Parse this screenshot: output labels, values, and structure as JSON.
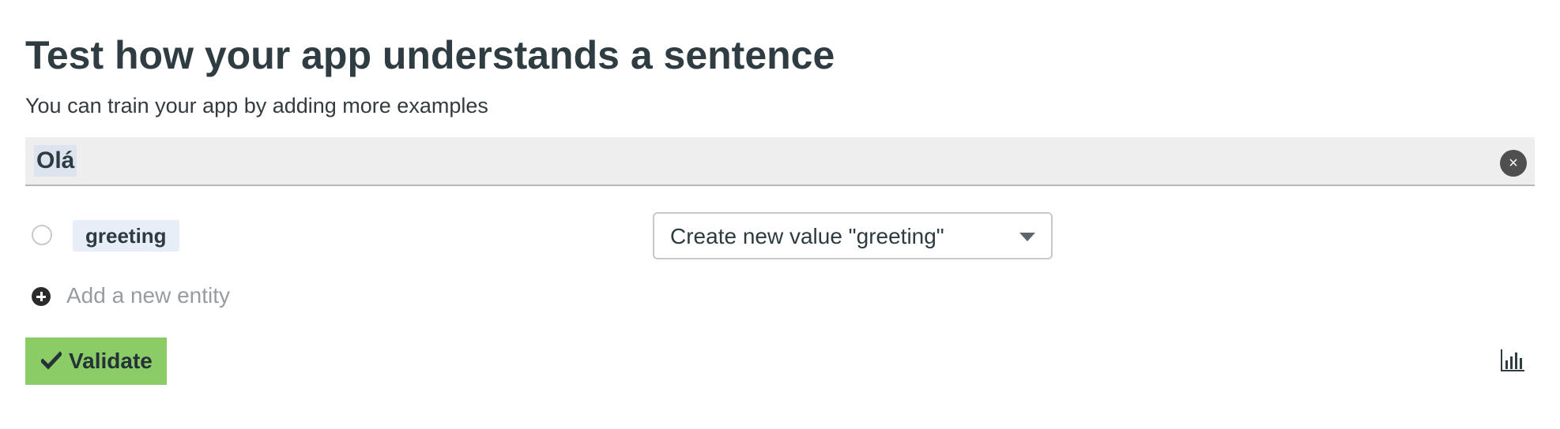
{
  "header": {
    "title": "Test how your app understands a sentence",
    "subtitle": "You can train your app by adding more examples"
  },
  "sentence": {
    "value": "Olá",
    "clear_icon": "×"
  },
  "entity": {
    "name": "greeting",
    "value_select": "Create new value \"greeting\""
  },
  "add_entity": {
    "label": "Add a new entity"
  },
  "actions": {
    "validate_label": "Validate"
  },
  "colors": {
    "validate_background": "#8ccc67",
    "entity_tag_background": "#e8eef8",
    "sentence_highlight": "#dde4ef"
  },
  "icons": {
    "clear": "close-circle-icon",
    "radio": "radio-unselected-icon",
    "dropdown": "chevron-down-icon",
    "add": "plus-circle-icon",
    "validate": "check-icon",
    "stats": "bar-chart-icon"
  }
}
